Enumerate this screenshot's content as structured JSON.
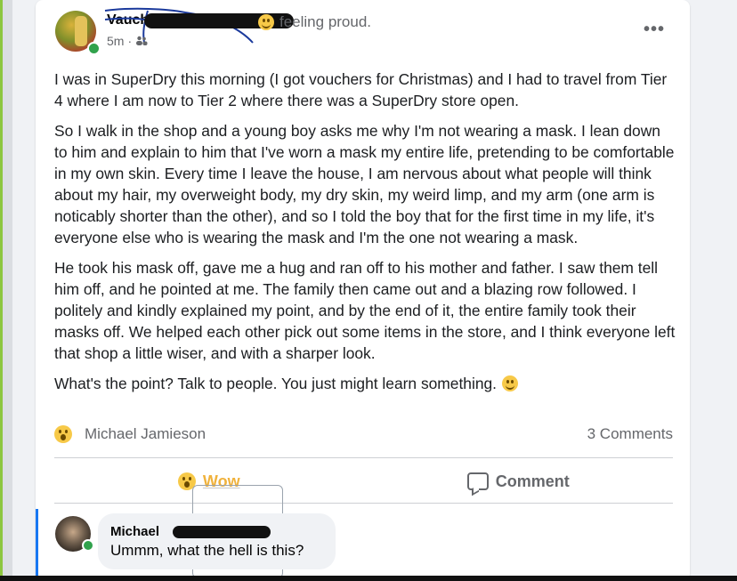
{
  "post": {
    "author": "Vauchian",
    "feeling": "feeling proud.",
    "time": "5m",
    "privacy_icon": "friends-icon",
    "more_icon": "more-options-icon",
    "more_label": "•••",
    "paragraphs": [
      "I was in SuperDry this morning (I got vouchers for Christmas) and I had to travel from Tier 4 where I am now to Tier 2 where there was a SuperDry store open.",
      "So I walk in the shop and a young boy asks me why I'm not wearing a mask. I lean down to him and explain to him that I've worn a mask my entire life, pretending to be comfortable in my own skin. Every time I leave the house, I am nervous about what people will think about my hair, my overweight body, my dry skin, my weird limp, and my arm (one arm is noticably shorter than the other), and so I told the boy that for the first time in my life, it's everyone else who is wearing the mask and I'm the one not wearing a mask.",
      "He took his mask off, gave me a hug and ran off to his mother and father. I saw them tell him off, and he pointed at me. The family then came out and a blazing row followed. I politely and kindly explained my point, and by the end of it, the entire family took their masks off. We helped each other pick out some items in the store, and I think everyone left that shop a little wiser, and with a sharper look.",
      "What's the point? Talk to people. You just might learn something."
    ]
  },
  "reactions": {
    "icon": "wow-reaction-icon",
    "reactor": "Michael Jamieson",
    "comments_count": "3 Comments"
  },
  "actions": {
    "wow_label": "Wow",
    "comment_label": "Comment"
  },
  "comment": {
    "author": "Michael",
    "text": "Ummm, what the hell is this?"
  },
  "colors": {
    "accent": "#1877f2",
    "wow": "#f0b23c",
    "online": "#31a24c",
    "muted": "#65676b"
  }
}
